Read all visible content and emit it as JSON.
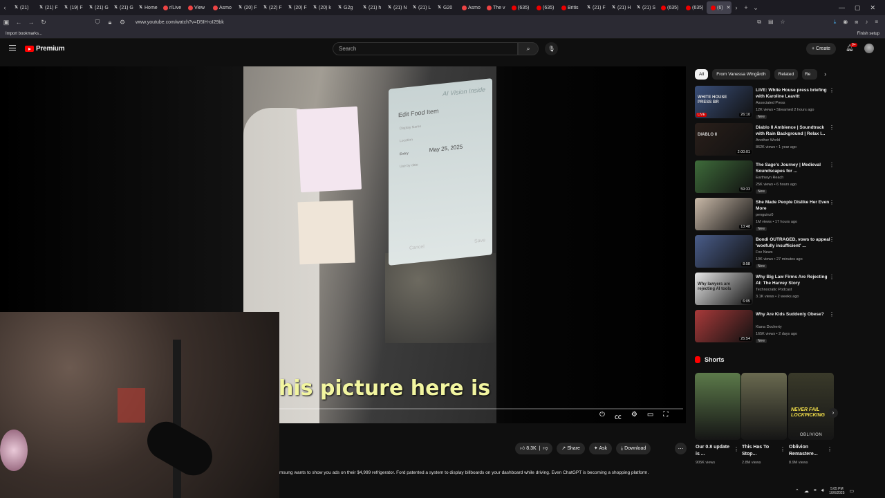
{
  "browser": {
    "tabs": [
      {
        "label": "(21)",
        "icon": "x-logo-icon"
      },
      {
        "label": "(21) F",
        "icon": "x-logo-icon"
      },
      {
        "label": "(19) F",
        "icon": "x-logo-icon"
      },
      {
        "label": "(21) G",
        "icon": "x-logo-icon"
      },
      {
        "label": "(21) G",
        "icon": "x-logo-icon"
      },
      {
        "label": "Home",
        "icon": "x-logo-icon"
      },
      {
        "label": "r/Live",
        "icon": "reddit-icon"
      },
      {
        "label": "View",
        "icon": "reddit-icon"
      },
      {
        "label": "Asmo",
        "icon": "reddit-icon"
      },
      {
        "label": "(20) F",
        "icon": "x-logo-icon"
      },
      {
        "label": "(22) F",
        "icon": "x-logo-icon"
      },
      {
        "label": "(20) F",
        "icon": "x-logo-icon"
      },
      {
        "label": "(20) k",
        "icon": "x-logo-icon"
      },
      {
        "label": "G2g",
        "icon": "x-logo-icon"
      },
      {
        "label": "(21) h",
        "icon": "x-logo-icon"
      },
      {
        "label": "(21) N",
        "icon": "x-logo-icon"
      },
      {
        "label": "(21) L",
        "icon": "x-logo-icon"
      },
      {
        "label": "G20",
        "icon": "x-logo-icon"
      },
      {
        "label": "Asmo",
        "icon": "reddit-icon"
      },
      {
        "label": "The v",
        "icon": "reddit-icon"
      },
      {
        "label": "(635)",
        "icon": "youtube-icon"
      },
      {
        "label": "(635)",
        "icon": "youtube-icon"
      },
      {
        "label": "Britis",
        "icon": "youtube-icon"
      },
      {
        "label": "(21) F",
        "icon": "x-logo-icon"
      },
      {
        "label": "(21) H",
        "icon": "x-logo-icon"
      },
      {
        "label": "(21) S",
        "icon": "x-logo-icon"
      },
      {
        "label": "(635)",
        "icon": "youtube-icon"
      },
      {
        "label": "(635)",
        "icon": "youtube-icon"
      },
      {
        "label": "(6)",
        "icon": "youtube-icon",
        "active": true
      }
    ],
    "url": "www.youtube.com/watch?v=D5IH-oI29bk",
    "bookmarks_import": "Import bookmarks...",
    "finish_setup": "Finish setup"
  },
  "youtube": {
    "logo_text": "Premium",
    "search_placeholder": "Search",
    "create_label": "Create",
    "notif_count": "9+"
  },
  "video": {
    "subtitle": "his picture here is",
    "fridge_brand": "AI Vision Inside",
    "fridge_form": {
      "title": "Edit Food Item",
      "field1": "Display Name",
      "field2": "Location",
      "entry_label": "Entry",
      "entry_value": "May 25, 2025",
      "field3": "Use by date",
      "cancel": "Cancel",
      "save": "Save"
    },
    "like_count": "8.3K",
    "share_label": "Share",
    "ask_label": "Ask",
    "download_label": "Download",
    "description": "msung wants to show you ads on their $4,999 refrigerator. Ford patented a system to display billboards on your dashboard while driving. Even ChatGPT is becoming a shopping platform."
  },
  "sidebar": {
    "chips": [
      "All",
      "From Vanessa Wingårdh",
      "Related",
      "Re"
    ],
    "recommendations": [
      {
        "title": "LIVE: White House press briefing with Karoline Leavitt",
        "channel": "Associated Press",
        "meta": "12K views • Streamed 2 hours ago",
        "duration": "26:10",
        "badge": "New",
        "live_tag": "LIVE",
        "thumb_caption": "WHITE HOUSE PRESS BR",
        "color": "#3a4f7a"
      },
      {
        "title": "Diablo II Ambience | Soundtrack with Rain Background | Relax I...",
        "channel": "Another World",
        "meta": "862K views • 1 year ago",
        "duration": "2:00:01",
        "badge": "",
        "thumb_caption": "DIABLO II",
        "color": "#2a1f1a"
      },
      {
        "title": "The Sage's Journey | Medieval Soundscapes for ...",
        "channel": "Earthwyn Reach",
        "meta": "25K views • 6 hours ago",
        "duration": "59:33",
        "badge": "New",
        "color": "#3e6b3a"
      },
      {
        "title": "She Made People Dislike Her Even More",
        "channel": "penguinz0",
        "meta": "1M views • 17 hours ago",
        "duration": "13:48",
        "badge": "New",
        "color": "#c9b9a8"
      },
      {
        "title": "Bondi OUTRAGED, vows to appeal 'woefully insufficient' ...",
        "channel": "Fox News",
        "meta": "10K views • 27 minutes ago",
        "duration": "8:58",
        "badge": "New",
        "color": "#4a5d8a"
      },
      {
        "title": "Why Big Law Firms Are Rejecting AI: The Harvey Story",
        "channel": "Technocratic Podcast",
        "meta": "3.1K views • 2 weeks ago",
        "duration": "6:05",
        "badge": "",
        "thumb_caption": "Why lawyers are rejecting AI tools",
        "color": "#e8e8e8"
      },
      {
        "title": "Why Are Kids Suddenly Obese?",
        "channel": "Kiana Docherty",
        "meta": "165K views • 2 days ago",
        "duration": "25:54",
        "badge": "New",
        "color": "#a83a3a"
      }
    ],
    "shorts_label": "Shorts",
    "shorts": [
      {
        "title": "Our 0.8 update is ...",
        "views": "905K views",
        "color": "#5c7a4a"
      },
      {
        "title": "This Has To Stop...",
        "views": "2.8M views",
        "color": "#6a6a50"
      },
      {
        "title": "Oblivion Remastere...",
        "views": "8.9M views",
        "caption_top": "NEVER FAIL LOCKPICKING",
        "caption_bottom": "OBLIVION",
        "color": "#3a3a2a"
      }
    ]
  },
  "taskbar": {
    "time": "5:05 PM",
    "date": "10/6/2025"
  }
}
